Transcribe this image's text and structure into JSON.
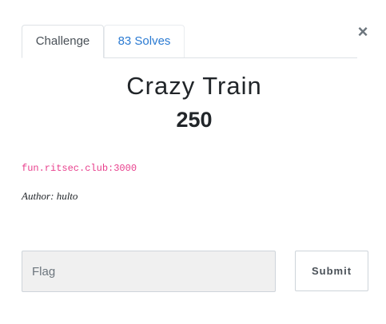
{
  "modal": {
    "close_label": "×"
  },
  "tabs": [
    {
      "label": "Challenge",
      "active": true
    },
    {
      "label": "83 Solves",
      "active": false
    }
  ],
  "challenge": {
    "title": "Crazy Train",
    "value": "250",
    "connection": "fun.ritsec.club:3000",
    "author": "Author: hulto"
  },
  "form": {
    "flag_placeholder": "Flag",
    "flag_value": "",
    "submit_label": "Submit"
  },
  "colors": {
    "link": "#2a7ad2",
    "code": "#e83e8c",
    "input_bg": "#f0f0f0"
  }
}
